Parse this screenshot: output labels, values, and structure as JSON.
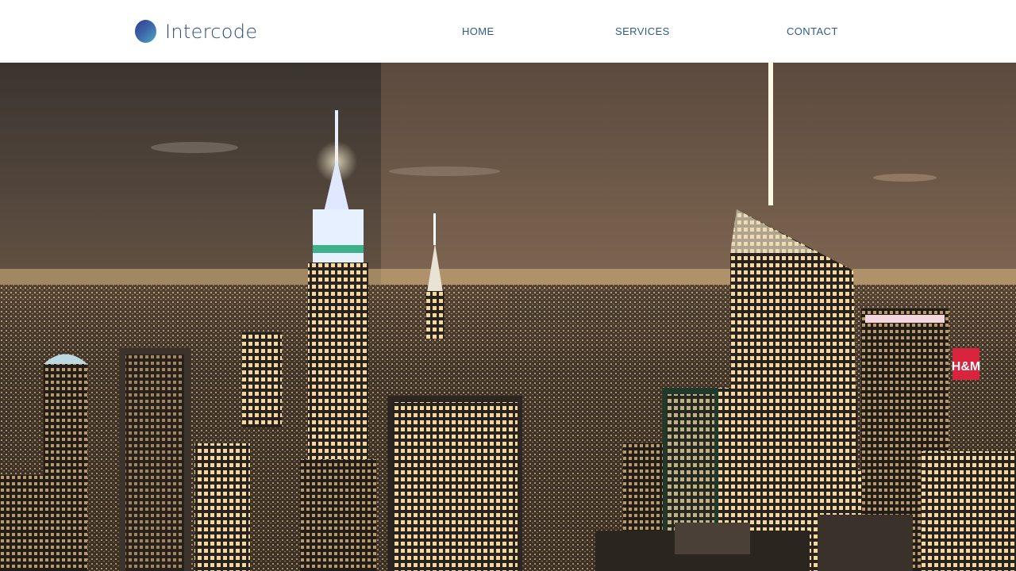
{
  "header": {
    "brand": "Intercode",
    "logo_icon": "gradient-circle-logo",
    "nav": [
      {
        "label": "HOME"
      },
      {
        "label": "SERVICES"
      },
      {
        "label": "CONTACT"
      }
    ]
  },
  "hero": {
    "image": "night-city-skyline-photo"
  },
  "colors": {
    "brand_text": "#2c4d78",
    "nav_text": "#2f5b86",
    "logo_gradient_start": "#2f3f8f",
    "logo_gradient_end": "#4fa7c4"
  }
}
